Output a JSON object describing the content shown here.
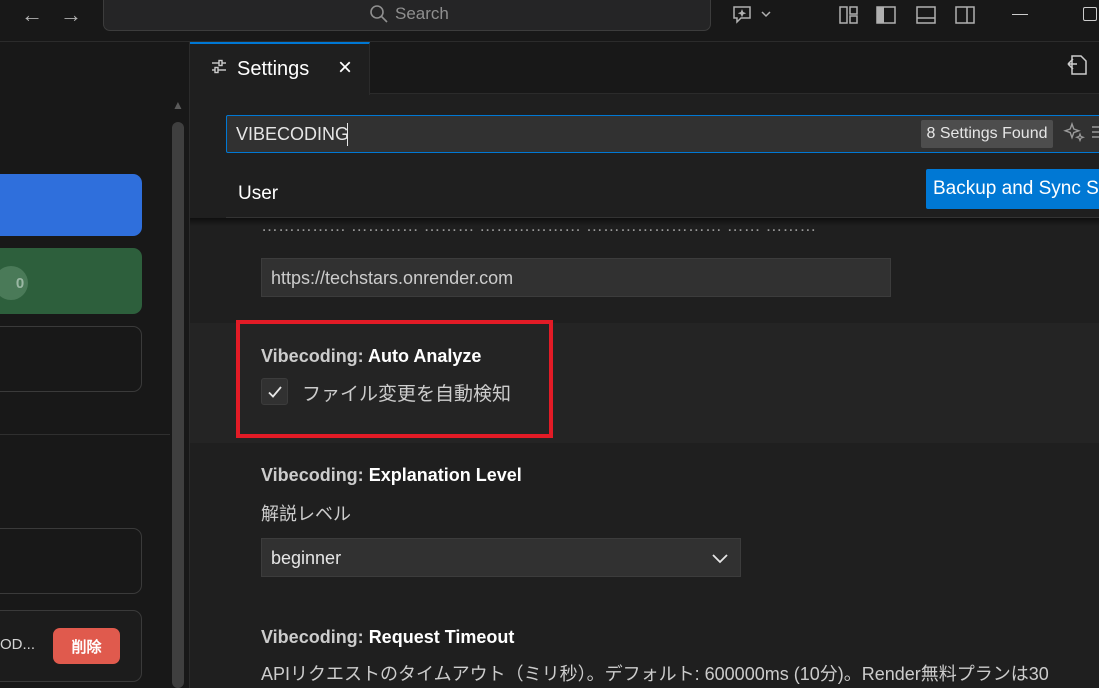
{
  "titlebar": {
    "back_icon": "arrow-left-icon",
    "forward_icon": "arrow-right-icon",
    "search_placeholder": "Search",
    "copilot_icon": "copilot-sparkle-icon",
    "layout_icons": [
      "customize-layout-icon",
      "toggle-primary-sidebar-icon",
      "toggle-panel-icon",
      "toggle-secondary-sidebar-icon"
    ],
    "window_controls": [
      "minimize-icon",
      "maximize-icon"
    ]
  },
  "sidebar": {
    "badge_text": "0",
    "item_label": "OD...",
    "delete_label": "削除"
  },
  "editor": {
    "tab": {
      "label": "Settings",
      "icon": "settings-sliders-icon"
    },
    "search": {
      "value": "VIBECODING",
      "found": "8 Settings Found"
    },
    "tabs": {
      "user_label": "User"
    },
    "backup_button": "Backup and Sync Settings"
  },
  "settings": {
    "server_url": "https://techstars.onrender.com",
    "items": [
      {
        "category": "Vibecoding: ",
        "name": "Auto Analyze",
        "description": "ファイル変更を自動検知",
        "checked": true
      },
      {
        "category": "Vibecoding: ",
        "name": "Explanation Level",
        "description": "解説レベル",
        "selected": "beginner"
      },
      {
        "category": "Vibecoding: ",
        "name": "Request Timeout",
        "description": "APIリクエストのタイムアウト（ミリ秒）。デフォルト: 600000ms (10分)。Render無料プランは30"
      }
    ]
  },
  "colors": {
    "accent": "#0078d4",
    "highlight_box": "#e21b26",
    "delete_button": "#e05a4d",
    "sidebar_blue": "#2f6fdc",
    "sidebar_green": "#2d5f3c"
  }
}
